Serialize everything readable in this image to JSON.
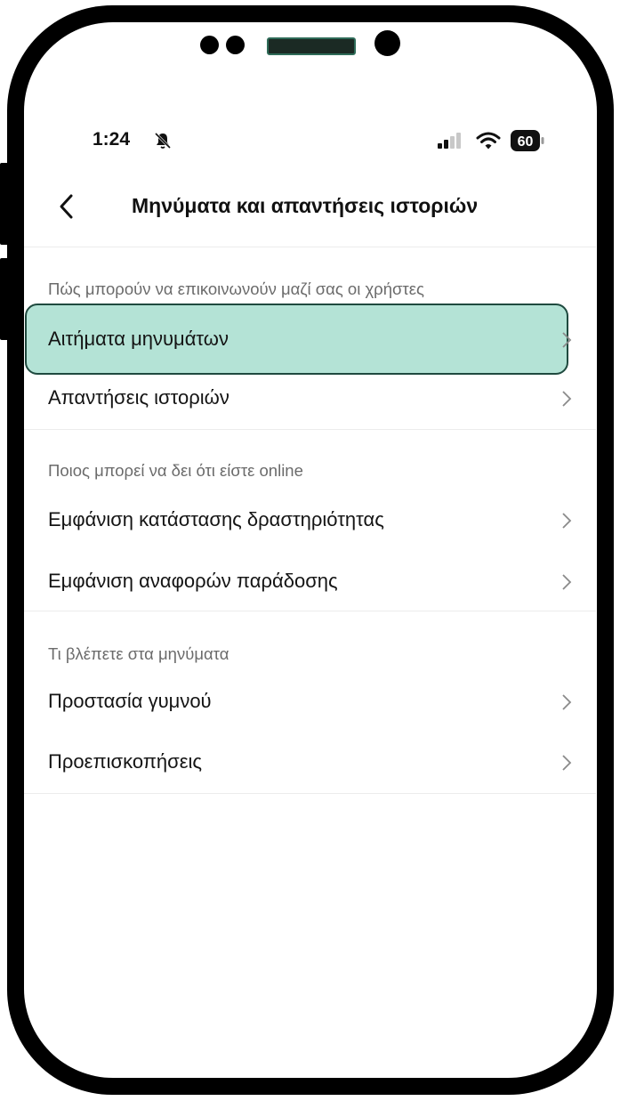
{
  "status_bar": {
    "time": "1:24",
    "battery": "60"
  },
  "header": {
    "title": "Μηνύματα και απαντήσεις ιστοριών"
  },
  "sections": [
    {
      "heading": "Πώς μπορούν να επικοινωνούν μαζί σας οι χρήστες",
      "items": [
        {
          "label": "Αιτήματα μηνυμάτων"
        },
        {
          "label": "Απαντήσεις ιστοριών"
        }
      ]
    },
    {
      "heading": "Ποιος μπορεί να δει ότι είστε online",
      "items": [
        {
          "label": "Εμφάνιση κατάστασης δραστηριότητας"
        },
        {
          "label": "Εμφάνιση αναφορών παράδοσης"
        }
      ]
    },
    {
      "heading": "Τι βλέπετε στα μηνύματα",
      "items": [
        {
          "label": "Προστασία γυμνού"
        },
        {
          "label": "Προεπισκοπήσεις"
        }
      ]
    }
  ],
  "colors": {
    "highlight": "#b4e3d6",
    "highlight_border": "#1f4a3f"
  }
}
